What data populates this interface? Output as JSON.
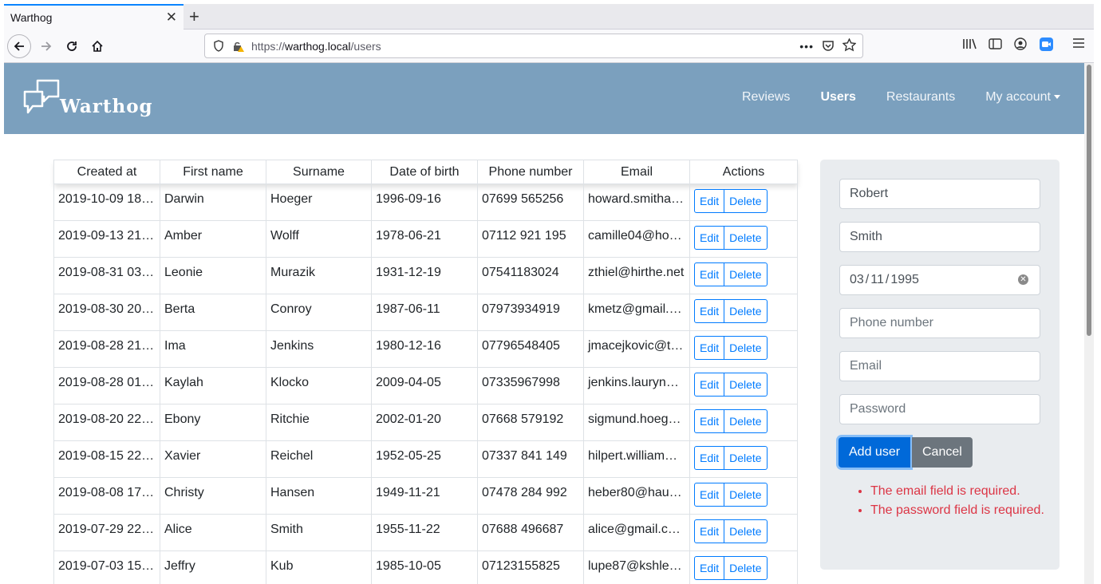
{
  "browser": {
    "tab_title": "Warthog",
    "url_prefix": "https://",
    "url_host": "warthog.local",
    "url_path": "/users"
  },
  "navbar": {
    "brand": "Warthog",
    "links": [
      "Reviews",
      "Users",
      "Restaurants",
      "My account"
    ]
  },
  "table": {
    "headers": [
      "Created at",
      "First name",
      "Surname",
      "Date of birth",
      "Phone number",
      "Email",
      "Actions"
    ],
    "edit_label": "Edit",
    "delete_label": "Delete",
    "rows": [
      [
        "2019-10-09 18…",
        "Darwin",
        "Hoeger",
        "1996-09-16",
        "07699 565256",
        "howard.smitha…"
      ],
      [
        "2019-09-13 21…",
        "Amber",
        "Wolff",
        "1978-06-21",
        "07112 921 195",
        "camille04@ho…"
      ],
      [
        "2019-08-31 03…",
        "Leonie",
        "Murazik",
        "1931-12-19",
        "07541183024",
        "zthiel@hirthe.net"
      ],
      [
        "2019-08-30 20…",
        "Berta",
        "Conroy",
        "1987-06-11",
        "07973934919",
        "kmetz@gmail.…"
      ],
      [
        "2019-08-28 21…",
        "Ima",
        "Jenkins",
        "1980-12-16",
        "07796548405",
        "jmacejkovic@t…"
      ],
      [
        "2019-08-28 01…",
        "Kaylah",
        "Klocko",
        "2009-04-05",
        "07335967998",
        "jenkins.lauryn…"
      ],
      [
        "2019-08-20 22…",
        "Ebony",
        "Ritchie",
        "2002-01-20",
        "07668 579192",
        "sigmund.hoeg…"
      ],
      [
        "2019-08-15 22…",
        "Xavier",
        "Reichel",
        "1952-05-25",
        "07337 841 149",
        "hilpert.william…"
      ],
      [
        "2019-08-08 17…",
        "Christy",
        "Hansen",
        "1949-11-21",
        "07478 284 992",
        "heber80@hau…"
      ],
      [
        "2019-07-29 22…",
        "Alice",
        "Smith",
        "1955-11-22",
        "07688 496687",
        "alice@gmail.c…"
      ],
      [
        "2019-07-03 15…",
        "Jeffry",
        "Kub",
        "1985-10-05",
        "07123155825",
        "lupe87@kshle…"
      ]
    ]
  },
  "form": {
    "first_name": "Robert",
    "surname": "Smith",
    "dob_month": "03",
    "dob_day": "11",
    "dob_year": "1995",
    "phone_placeholder": "Phone number",
    "email_placeholder": "Email",
    "password_placeholder": "Password",
    "submit_label": "Add user",
    "cancel_label": "Cancel",
    "errors": [
      "The email field is required.",
      "The password field is required."
    ]
  },
  "colors": {
    "navbar": "#7ba0be",
    "primary": "#007bff",
    "danger": "#dc3545"
  }
}
